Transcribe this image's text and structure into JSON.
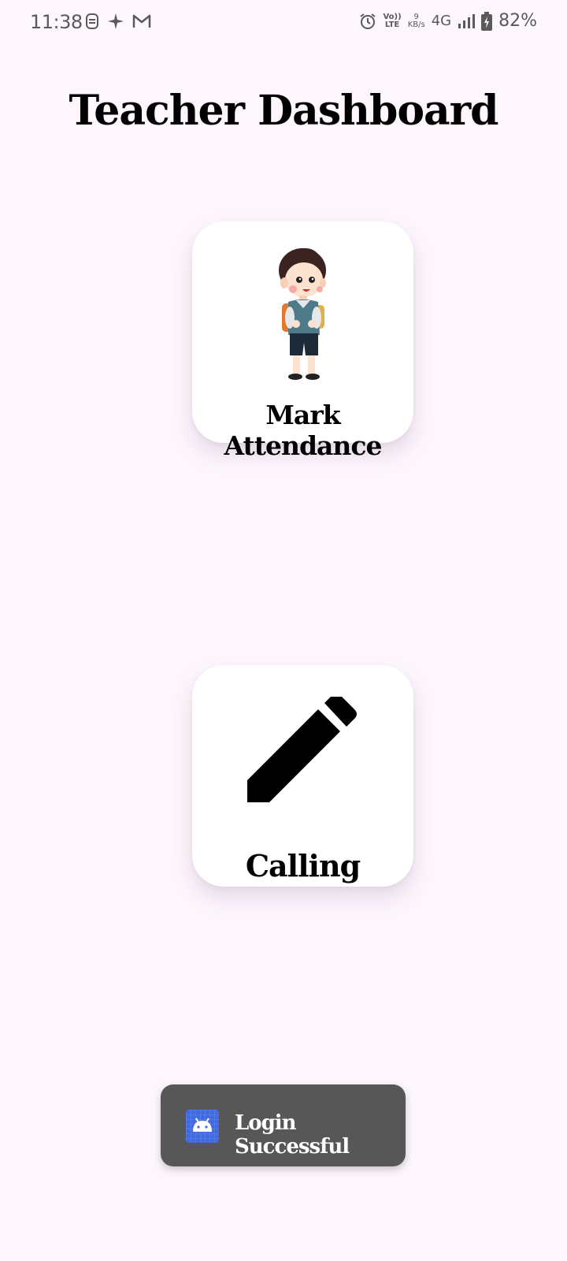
{
  "status_bar": {
    "time": "11:38",
    "left_icons": [
      "sim-icon",
      "sparkle-icon",
      "gmail-icon"
    ],
    "right_icons": [
      "alarm-icon",
      "volte-icon",
      "data-speed-icon",
      "network-icon",
      "signal-icon",
      "battery-icon"
    ],
    "volte_top": "Vo))",
    "volte_bottom": "LTE",
    "data_speed_value": "9",
    "data_speed_unit": "KB/s",
    "network_type": "4G",
    "battery_percent": "82%"
  },
  "header": {
    "title": "Teacher Dashboard"
  },
  "cards": {
    "attendance": {
      "label": "Mark Attendance",
      "icon": "student-illustration"
    },
    "calling": {
      "label": "Calling",
      "icon": "pencil-icon"
    }
  },
  "toast": {
    "message": "Login Successful",
    "icon": "android-icon"
  },
  "colors": {
    "background": "#fdf6fd",
    "card": "#ffffff",
    "toast": "#575757",
    "toast_icon": "#3f6ae0"
  }
}
